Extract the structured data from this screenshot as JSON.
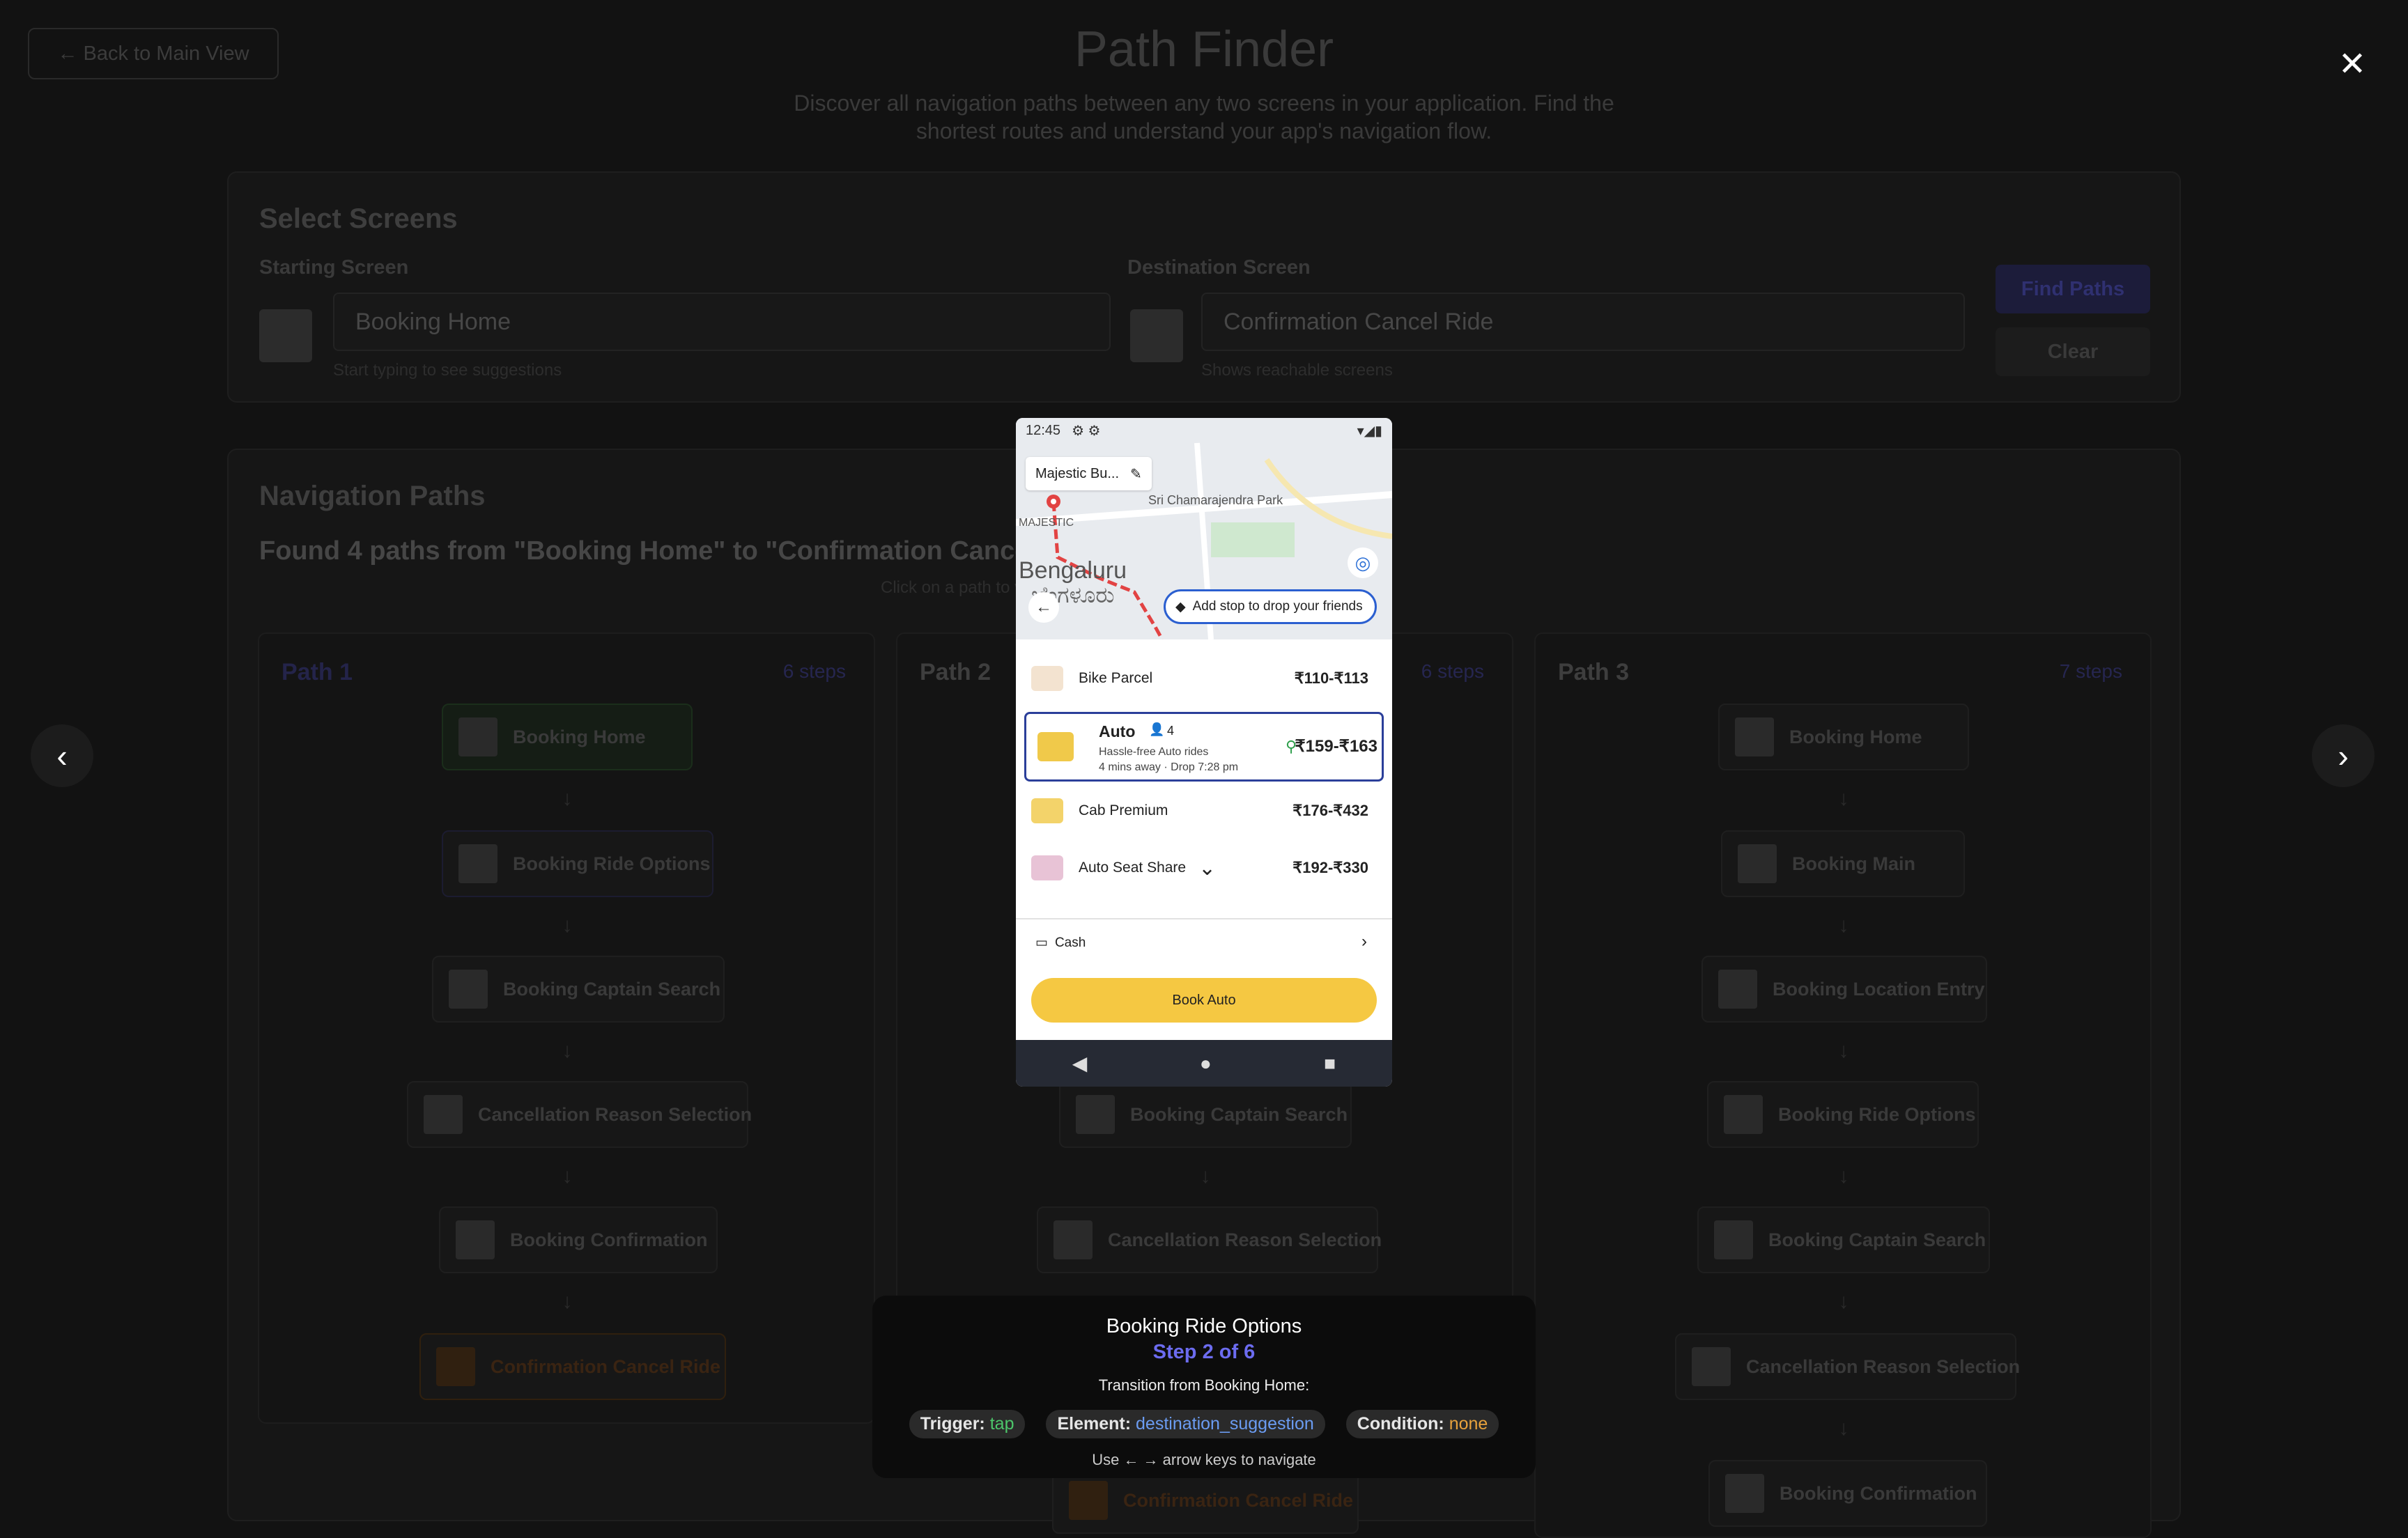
{
  "page": {
    "back_button": "← Back to Main View",
    "title": "Path Finder",
    "subtitle": "Discover all navigation paths between any two screens in your application. Find the shortest routes and understand your app's navigation flow."
  },
  "select": {
    "heading": "Select Screens",
    "start_label": "Starting Screen",
    "start_value": "Booking Home",
    "start_hint": "Start typing to see suggestions",
    "dest_label": "Destination Screen",
    "dest_value": "Confirmation Cancel Ride",
    "dest_hint": "Shows reachable screens",
    "find_button": "Find Paths",
    "clear_button": "Clear"
  },
  "results": {
    "heading": "Navigation Paths",
    "found_text": "Found 4 paths from \"Booking Home\" to \"Confirmation Cancel Ride\"",
    "hint": "Click on a path to view screen images",
    "paths": [
      {
        "title": "Path 1",
        "steps": "6 steps",
        "nodes": [
          "Booking Home",
          "Booking Ride Options",
          "Booking Captain Search",
          "Cancellation Reason Selection",
          "Booking Confirmation",
          "Confirmation Cancel Ride"
        ]
      },
      {
        "title": "Path 2",
        "steps": "6 steps",
        "nodes": [
          "Booking Captain Search",
          "Cancellation Reason Selection",
          "Confirmation Cancel Ride"
        ]
      },
      {
        "title": "Path 3",
        "steps": "7 steps",
        "nodes": [
          "Booking Home",
          "Booking Main",
          "Booking Location Entry",
          "Booking Ride Options",
          "Booking Captain Search",
          "Cancellation Reason Selection",
          "Booking Confirmation"
        ]
      }
    ]
  },
  "modal": {
    "close": "✕",
    "prev": "‹",
    "next": "›",
    "screen": {
      "time": "12:45",
      "pickup": "Majestic Bu...",
      "park": "Sri Chamarajendra Park",
      "majestic": "MAJESTIC",
      "city": "Bengaluru",
      "city_kn": "ಬೆಂಗಳೂರು",
      "add_stop": "Add stop to drop your friends",
      "rides": [
        {
          "name": "Bike Parcel",
          "price": "₹110-₹113"
        },
        {
          "name": "Auto",
          "seats": "4",
          "desc": "Hassle-free Auto rides",
          "eta": "4 mins away · Drop 7:28 pm",
          "price": "₹159-₹163"
        },
        {
          "name": "Cab Premium",
          "price": "₹176-₹432"
        },
        {
          "name": "Auto Seat Share",
          "price": "₹192-₹330"
        }
      ],
      "payment": "Cash",
      "book_button": "Book Auto"
    },
    "info": {
      "title": "Booking Ride Options",
      "step": "Step 2 of 6",
      "transition": "Transition from Booking Home:",
      "trigger_label": "Trigger:",
      "trigger_value": "tap",
      "element_label": "Element:",
      "element_value": "destination_suggestion",
      "condition_label": "Condition:",
      "condition_value": "none",
      "hint": "Use ← → arrow keys to navigate"
    }
  }
}
